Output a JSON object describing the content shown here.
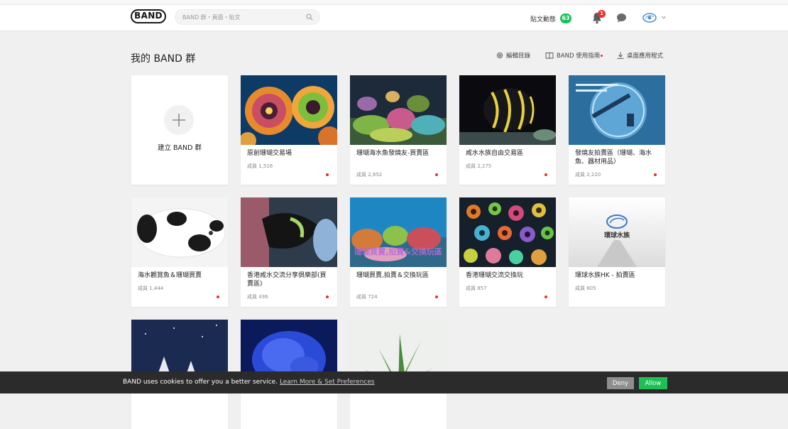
{
  "header": {
    "logo": "BAND",
    "search_placeholder": "BAND 群・頁面・貼文",
    "posts_activity_label": "貼文動態",
    "posts_activity_count": "63",
    "notification_count": "1"
  },
  "main": {
    "title": "我的 BAND 群",
    "toolbar": {
      "edit_list": "編輯目錄",
      "guide": "BAND 使用指南",
      "desktop_app": "桌面應用程式"
    },
    "create_label": "建立 BAND 群",
    "bands": [
      {
        "name": "原創珊瑚交易場",
        "members": "成員 1,516",
        "new": true
      },
      {
        "name": "珊瑚海水魚發燒友-買賣區",
        "members": "成員 2,852",
        "new": true
      },
      {
        "name": "咸水水族自由交易區",
        "members": "成員 2,275",
        "new": true
      },
      {
        "name": "發燒友拍賣區（珊瑚、海水魚、器材用品）",
        "members": "成員 2,220",
        "new": true
      },
      {
        "name": "海水觀賞魚＆珊瑚買賣",
        "members": "成員 1,444",
        "new": true
      },
      {
        "name": "香港咸水交流分享俱樂部(買賣區)",
        "members": "成員 436",
        "new": true
      },
      {
        "name": "珊瑚買賣,拍賣＆交換玩區",
        "members": "成員 724",
        "new": true
      },
      {
        "name": "香港珊瑚交流交換玩",
        "members": "成員 857",
        "new": true
      },
      {
        "name": "環球水族HK - 拍賣區",
        "members": "成員 805",
        "new": false
      }
    ],
    "cover_texts": {
      "band7_overlay": "珊瑚買賣,拍賣&交換玩區",
      "band9_logo": "環球水族"
    }
  },
  "cookie_banner": {
    "text": "BAND uses cookies to offer you a better service.",
    "link": "Learn More & Set Preferences",
    "deny": "Deny",
    "allow": "Allow"
  },
  "colors": {
    "accent_green": "#1fbf57",
    "alert_red": "#e8312a",
    "banner_bg": "#2b2b2b"
  }
}
